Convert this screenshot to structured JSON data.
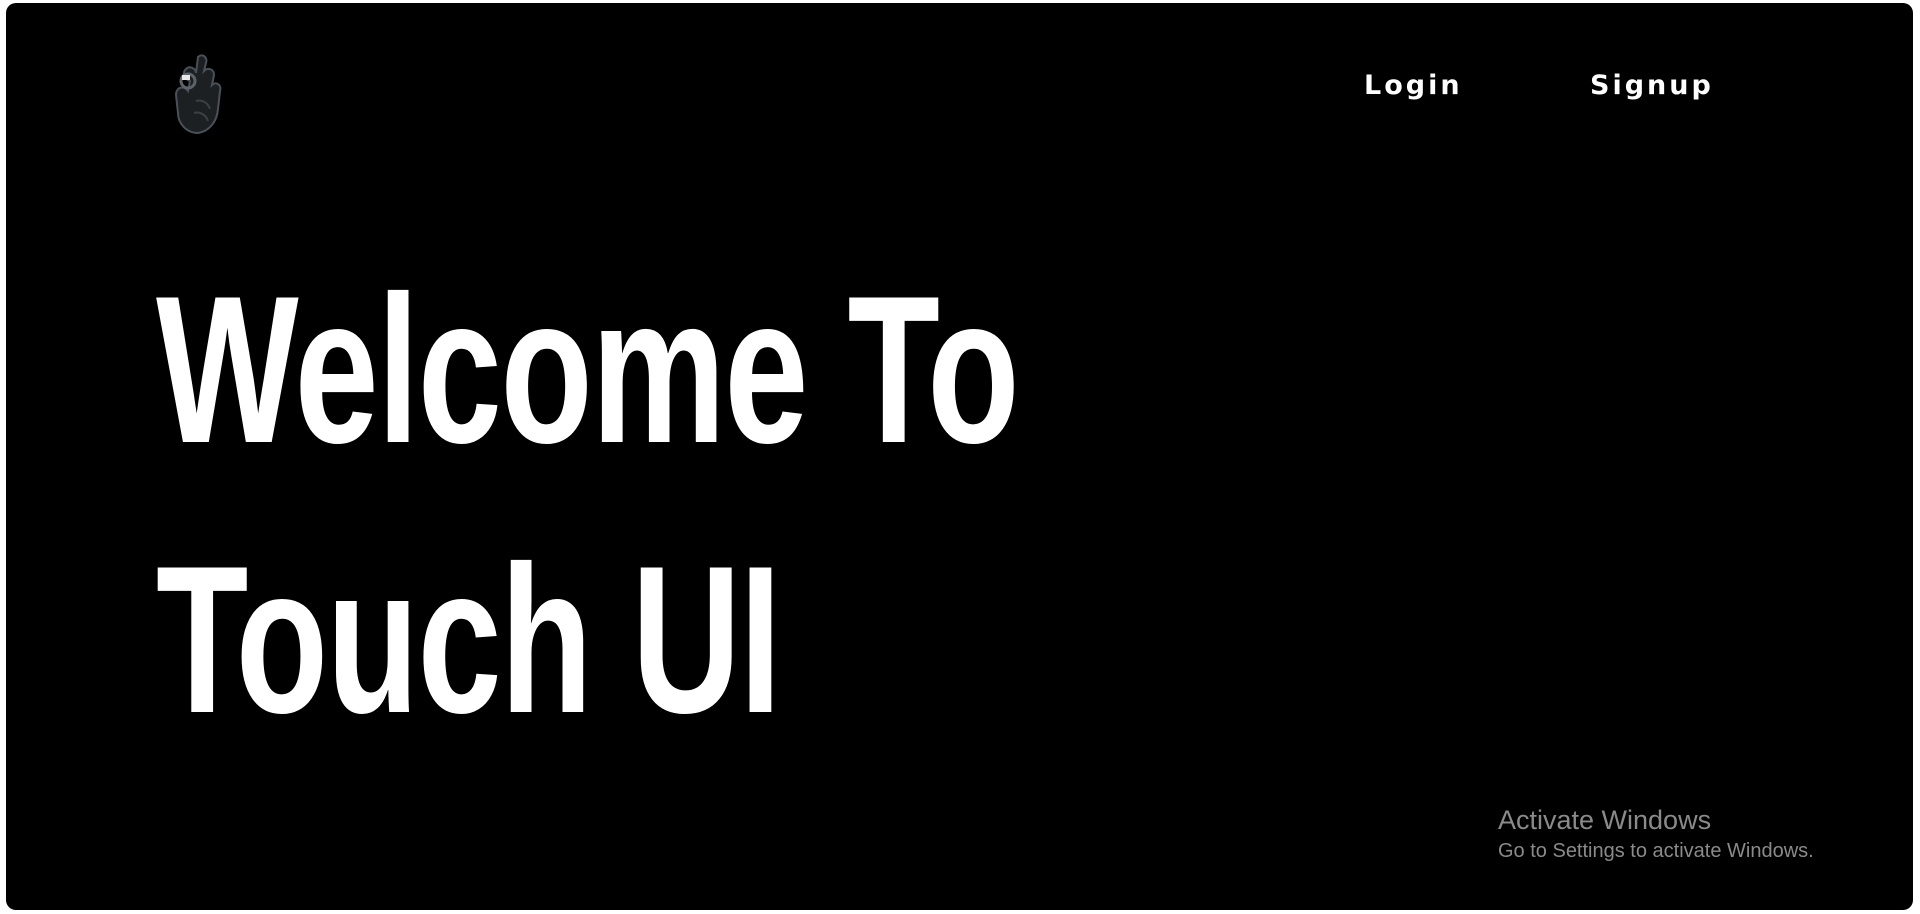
{
  "header": {
    "logo_icon": "ok-hand-icon",
    "nav": {
      "login_label": "Login",
      "signup_label": "Signup"
    }
  },
  "hero": {
    "line1": "Welcome To",
    "line2": "Touch UI"
  },
  "os_watermark": {
    "title": "Activate Windows",
    "subtitle": "Go to Settings to activate Windows."
  },
  "colors": {
    "background": "#000000",
    "text": "#ffffff",
    "watermark": "#8a8a8a"
  }
}
